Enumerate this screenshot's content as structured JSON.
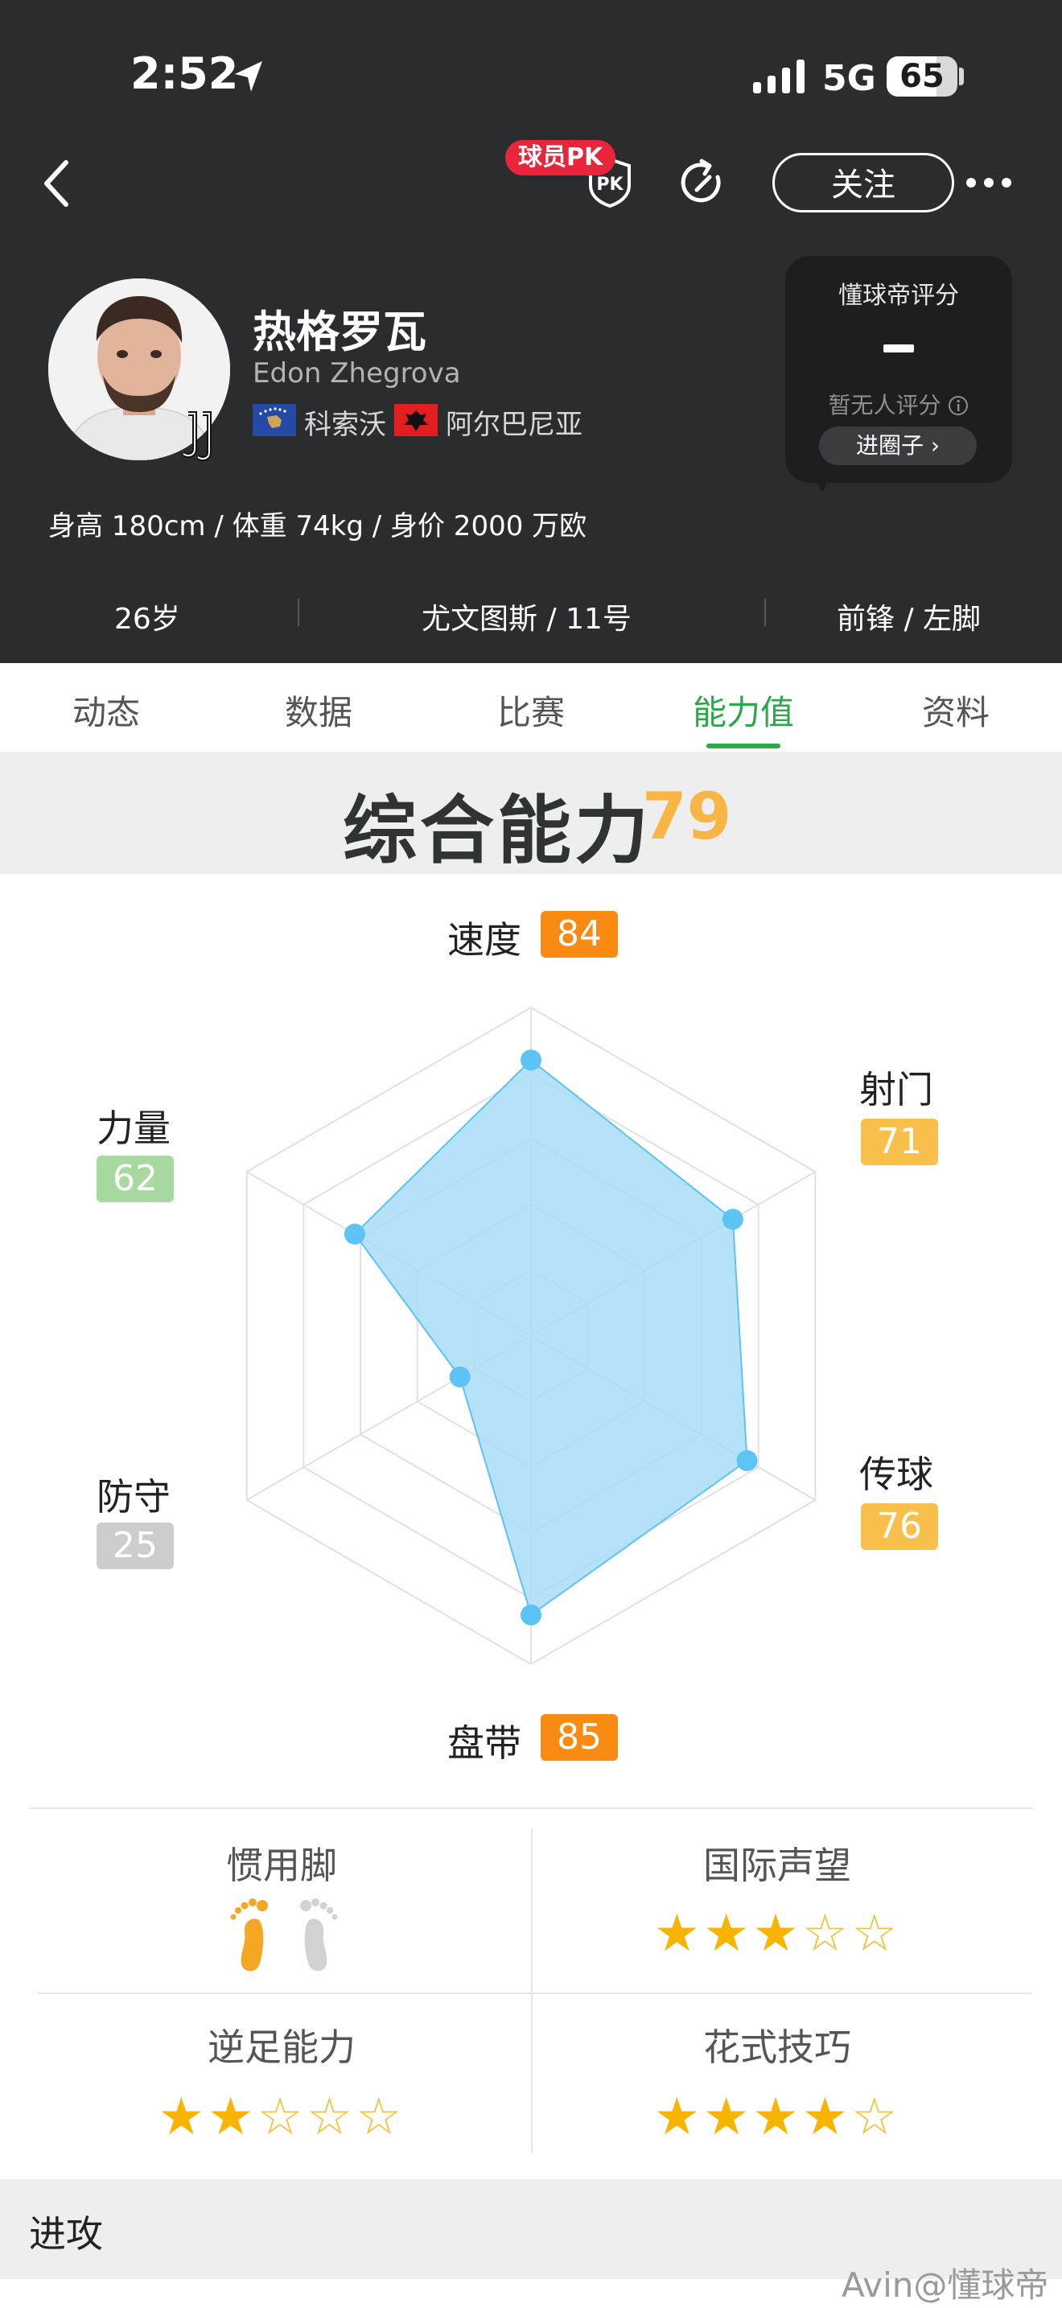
{
  "status_bar": {
    "time": "2:52",
    "network": "5G",
    "battery": "65"
  },
  "nav": {
    "pk_badge": "球员PK",
    "pk_icon_text": "PK",
    "follow_label": "关注"
  },
  "player": {
    "name": "热格罗瓦",
    "name_en": "Edon Zhegrova",
    "nationality_1": "科索沃",
    "nationality_2": "阿尔巴尼亚",
    "stats": "身高 180cm / 体重 74kg / 身价 2000 万欧",
    "age": "26岁",
    "club_number": "尤文图斯 / 11号",
    "position_foot": "前锋 / 左脚"
  },
  "rating": {
    "title": "懂球帝评分",
    "none_text": "暂无人评分",
    "button": "进圈子 ›"
  },
  "tabs": [
    "动态",
    "数据",
    "比赛",
    "能力值",
    "资料"
  ],
  "active_tab": 3,
  "ability": {
    "title": "综合能力",
    "overall": "79",
    "attributes": [
      {
        "label": "速度",
        "value": 84,
        "value_text": "84",
        "color": "#f98a12"
      },
      {
        "label": "射门",
        "value": 71,
        "value_text": "71",
        "color": "#f9c04b"
      },
      {
        "label": "传球",
        "value": 76,
        "value_text": "76",
        "color": "#f9c04b"
      },
      {
        "label": "盘带",
        "value": 85,
        "value_text": "85",
        "color": "#f98a12"
      },
      {
        "label": "防守",
        "value": 25,
        "value_text": "25",
        "color": "#cdcdcd"
      },
      {
        "label": "力量",
        "value": 62,
        "value_text": "62",
        "color": "#a7d9a0"
      }
    ],
    "radar_fill": "#a8ddf8",
    "radar_point": "#5cc3f5"
  },
  "traits": {
    "preferred_foot": {
      "label": "惯用脚",
      "left_active": true,
      "right_active": false
    },
    "intl_reputation": {
      "label": "国际声望",
      "stars": 3,
      "max": 5
    },
    "weak_foot": {
      "label": "逆足能力",
      "stars": 2,
      "max": 5
    },
    "skill_moves": {
      "label": "花式技巧",
      "stars": 4,
      "max": 5
    }
  },
  "attack_section": "进攻",
  "watermark": "Avin@懂球帝"
}
